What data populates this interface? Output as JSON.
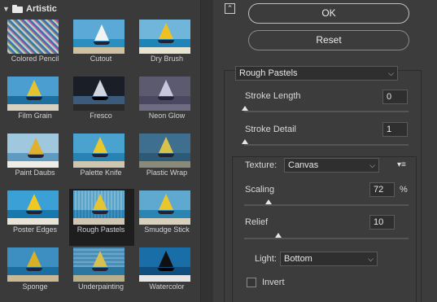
{
  "gallery": {
    "folder_label": "Artistic",
    "thumbs": [
      {
        "label": "Colored Pencil"
      },
      {
        "label": "Cutout"
      },
      {
        "label": "Dry Brush"
      },
      {
        "label": "Film Grain"
      },
      {
        "label": "Fresco"
      },
      {
        "label": "Neon Glow"
      },
      {
        "label": "Paint Daubs"
      },
      {
        "label": "Palette Knife"
      },
      {
        "label": "Plastic Wrap"
      },
      {
        "label": "Poster Edges"
      },
      {
        "label": "Rough Pastels"
      },
      {
        "label": "Smudge Stick"
      },
      {
        "label": "Sponge"
      },
      {
        "label": "Underpainting"
      },
      {
        "label": "Watercolor"
      }
    ],
    "selected": "Rough Pastels"
  },
  "buttons": {
    "ok": "OK",
    "reset": "Reset"
  },
  "filter": {
    "name": "Rough Pastels",
    "stroke_length_label": "Stroke Length",
    "stroke_length": "0",
    "stroke_detail_label": "Stroke Detail",
    "stroke_detail": "1",
    "texture_label": "Texture:",
    "texture": "Canvas",
    "scaling_label": "Scaling",
    "scaling": "72",
    "scaling_unit": "%",
    "relief_label": "Relief",
    "relief": "10",
    "light_label": "Light:",
    "light": "Bottom",
    "invert_label": "Invert",
    "invert_checked": false
  },
  "colors": {
    "panel_bg": "#3c3c3c",
    "selected_thumb_bg": "#1e1e1e"
  }
}
